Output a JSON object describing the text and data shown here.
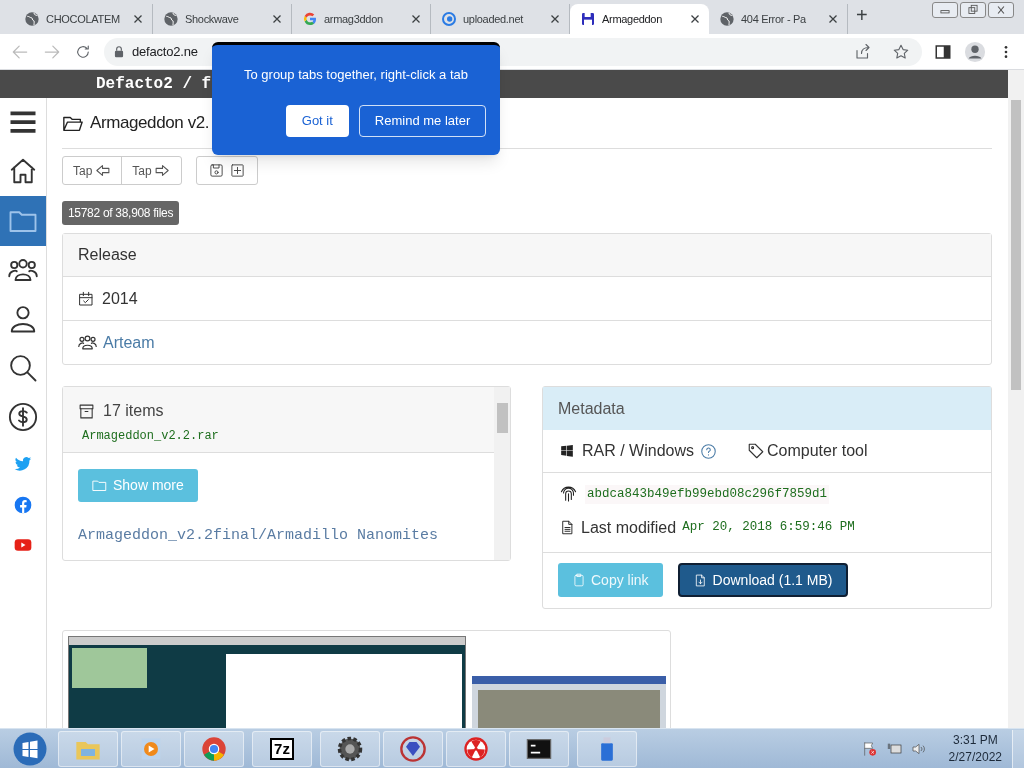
{
  "browser": {
    "tabs": [
      {
        "kind": "globe",
        "title": "CHOCOLATEM",
        "selected": false
      },
      {
        "kind": "globe",
        "title": "Shockwave",
        "selected": false
      },
      {
        "kind": "google",
        "title": "armag3ddon",
        "selected": false
      },
      {
        "kind": "uploaded",
        "title": "uploaded.net",
        "selected": false
      },
      {
        "kind": "floppy",
        "title": "Armageddon",
        "selected": true
      },
      {
        "kind": "globe",
        "title": "404 Error - Pa",
        "selected": false
      }
    ],
    "new_tab": "+",
    "address": "defacto2.ne"
  },
  "popup": {
    "message": "To group tabs together, right-click a tab",
    "primary": "Got it",
    "secondary": "Remind me later"
  },
  "site": {
    "header": "Defacto2 / f",
    "sidebar": [
      {
        "kind": "menu",
        "selected": false
      },
      {
        "kind": "home",
        "selected": false
      },
      {
        "kind": "folder",
        "selected": true
      },
      {
        "kind": "group",
        "selected": false
      },
      {
        "kind": "person",
        "selected": false
      },
      {
        "kind": "search",
        "selected": false
      },
      {
        "kind": "dollar",
        "selected": false
      },
      {
        "kind": "twitter",
        "selected": false
      },
      {
        "kind": "facebook",
        "selected": false
      },
      {
        "kind": "youtube",
        "selected": false
      }
    ]
  },
  "page": {
    "title": "Armageddon v2.",
    "nav": [
      "Tap",
      "Tap"
    ],
    "file_count": "15782 of 38,908 files",
    "release": {
      "heading": "Release",
      "year": "2014",
      "group": "Arteam"
    },
    "archive": {
      "count": "17 items",
      "filename": "Armageddon_v2.2.rar",
      "button": "Show more",
      "path": "Armageddon_v2.2final/Armadillo Nanomites"
    },
    "metadata": {
      "heading": "Metadata",
      "platform": "RAR / Windows",
      "category": "Computer tool",
      "hash": "abdca843b49efb99ebd08c296f7859d1",
      "modified_label": "Last modified",
      "modified": "Apr 20, 2018 6:59:46 PM",
      "copy_button": "Copy link",
      "download_button": "Download (1.1 MB)"
    }
  },
  "taskbar": {
    "apps": [
      {
        "kind": "explorer"
      },
      {
        "kind": "media"
      },
      {
        "kind": "chrome"
      },
      {
        "kind": "archiver",
        "label": "7z"
      },
      {
        "kind": "gear"
      },
      {
        "kind": "gem"
      },
      {
        "kind": "radiation"
      },
      {
        "kind": "console"
      },
      {
        "kind": "usb"
      }
    ],
    "time": "3:31 PM",
    "date": "2/27/2022"
  }
}
